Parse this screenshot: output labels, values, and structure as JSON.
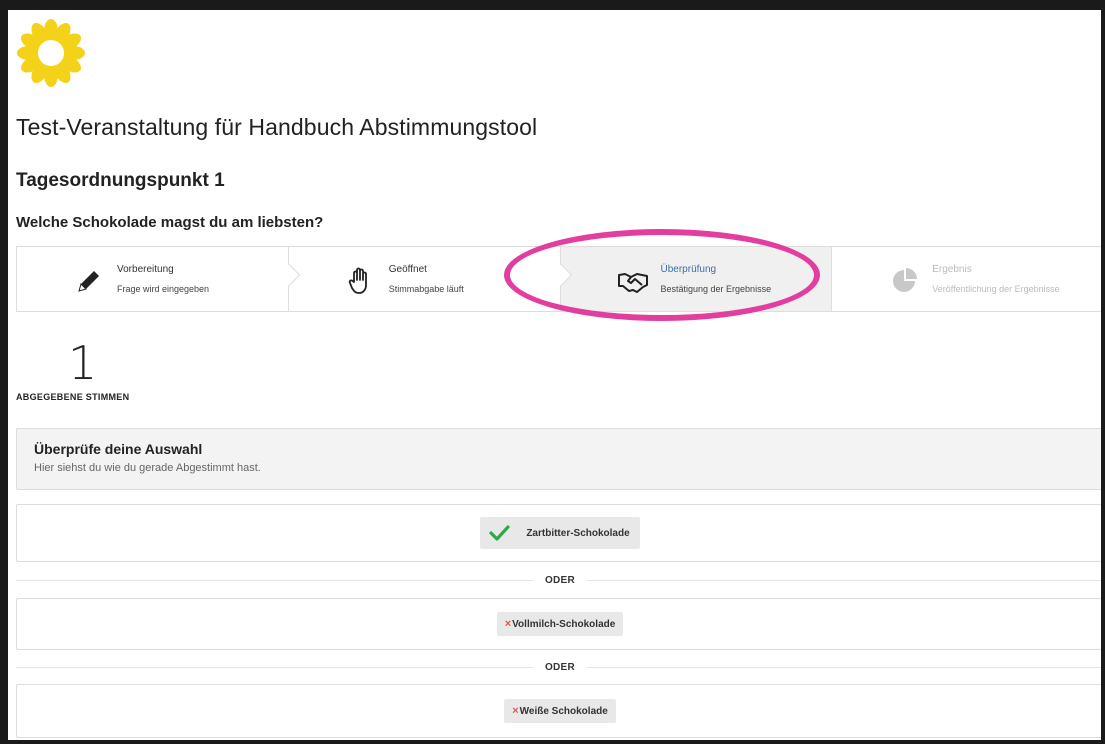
{
  "event_title": "Test-Veranstaltung für Handbuch Abstimmungstool",
  "agenda_item": "Tagesordnungspunkt 1",
  "question": "Welche Schokolade magst du am liebsten?",
  "steps": [
    {
      "title": "Vorbereitung",
      "subtitle": "Frage wird eingegeben",
      "icon": "pencil-icon",
      "state": "done"
    },
    {
      "title": "Geöffnet",
      "subtitle": "Stimmabgabe läuft",
      "icon": "hand-icon",
      "state": "done"
    },
    {
      "title": "Überprüfung",
      "subtitle": "Bestätigung der Ergebnisse",
      "icon": "handshake-icon",
      "state": "active"
    },
    {
      "title": "Ergebnis",
      "subtitle": "Veröffentlichung der Ergebnisse",
      "icon": "pie-chart-icon",
      "state": "upcoming"
    }
  ],
  "votes": {
    "count": "1",
    "label": "ABGEGEBENE STIMMEN"
  },
  "review": {
    "title": "Überprüfe deine Auswahl",
    "subtitle": "Hier siehst du wie du gerade Abgestimmt hast."
  },
  "options": [
    {
      "label": "Zartbitter-Schokolade",
      "selected": true
    },
    {
      "label": "Vollmilch-Schokolade",
      "selected": false
    },
    {
      "label": "Weiße Schokolade",
      "selected": false
    }
  ],
  "separator": "ODER",
  "colors": {
    "highlight": "#e23e9f",
    "accent": "#3b6ea8",
    "check": "#2ea84a",
    "cross": "#e05555",
    "logo": "#f5d21a"
  }
}
